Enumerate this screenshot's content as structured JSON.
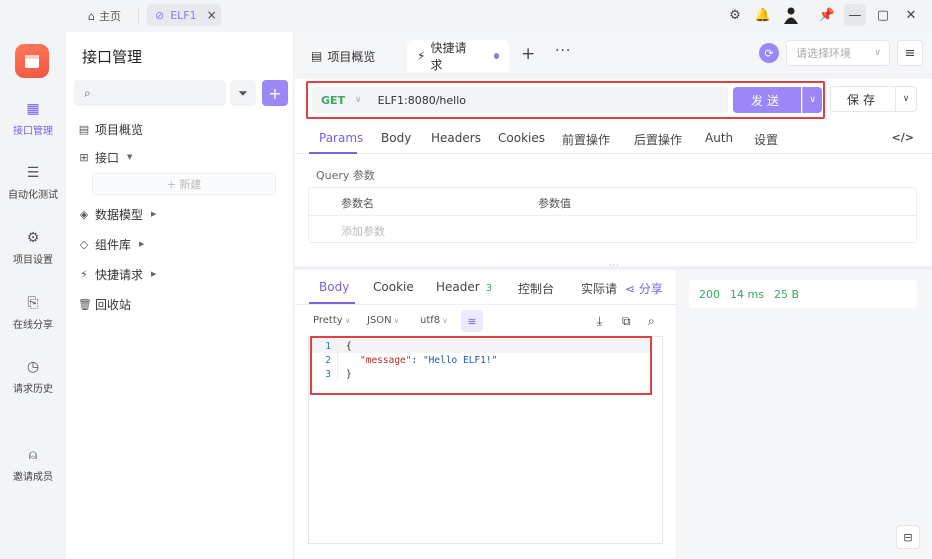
{
  "titlebar": {
    "home_label": "主页",
    "tab_label": "ELF1"
  },
  "leftnav": {
    "items": [
      {
        "label": "接口管理"
      },
      {
        "label": "自动化测试"
      },
      {
        "label": "项目设置"
      },
      {
        "label": "在线分享"
      },
      {
        "label": "请求历史"
      },
      {
        "label": "邀请成员"
      }
    ]
  },
  "sidebar": {
    "title": "接口管理",
    "new_label": "+ 新建",
    "items": [
      {
        "label": "项目概览"
      },
      {
        "label": "接口"
      },
      {
        "label": "数据模型"
      },
      {
        "label": "组件库"
      },
      {
        "label": "快捷请求"
      },
      {
        "label": "回收站"
      }
    ]
  },
  "main": {
    "tabs": [
      {
        "label": "项目概览"
      },
      {
        "label": "快捷请求"
      }
    ],
    "env_placeholder": "请选择环境",
    "request": {
      "method": "GET",
      "url": "ELF1:8080/hello",
      "send_label": "发送",
      "save_label": "保存"
    },
    "req_tabs": [
      "Params",
      "Body",
      "Headers",
      "Cookies",
      "前置操作",
      "后置操作",
      "Auth",
      "设置"
    ],
    "query": {
      "label": "Query 参数",
      "col_name": "参数名",
      "col_value": "参数值",
      "add_placeholder": "添加参数"
    },
    "response": {
      "tabs": [
        {
          "label": "Body"
        },
        {
          "label": "Cookie"
        },
        {
          "label": "Header",
          "count": "3"
        },
        {
          "label": "控制台"
        },
        {
          "label": "实际请"
        }
      ],
      "share_label": "分享",
      "format": {
        "pretty": "Pretty",
        "lang": "JSON",
        "encoding": "utf8"
      },
      "code": {
        "line_numbers": [
          "1",
          "2",
          "3"
        ],
        "open_brace": "{",
        "key": "\"message\"",
        "colon": ": ",
        "value": "\"Hello ELF1!\"",
        "close_brace": "}"
      },
      "status": {
        "code": "200",
        "time": "14 ms",
        "size": "25 B"
      }
    }
  },
  "colors": {
    "accent": "#9b87f5",
    "method_get": "#3aa760",
    "highlight_border": "#e24040"
  }
}
